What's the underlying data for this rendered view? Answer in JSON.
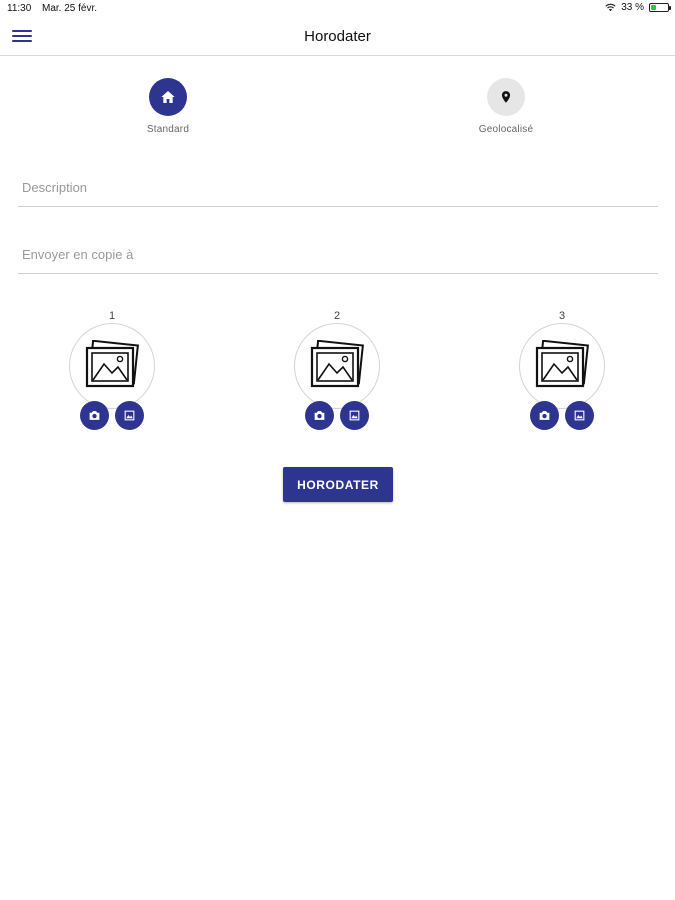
{
  "status_bar": {
    "time": "11:30",
    "date": "Mar. 25 févr.",
    "battery_text": "33 %",
    "battery_level": 0.33,
    "icons": [
      "wifi-icon",
      "battery-icon"
    ]
  },
  "header": {
    "title": "Horodater",
    "menu_icon": "hamburger-menu-icon"
  },
  "modes": [
    {
      "label": "Standard",
      "icon": "home-icon",
      "selected": true
    },
    {
      "label": "Geolocalisé",
      "icon": "location-pin-icon",
      "selected": false
    }
  ],
  "form": {
    "description_placeholder": "Description",
    "description_value": "",
    "copy_placeholder": "Envoyer en copie à",
    "copy_value": ""
  },
  "photos": [
    {
      "number": "1",
      "icon": "image-placeholder-icon",
      "actions": [
        "camera-icon",
        "gallery-icon"
      ]
    },
    {
      "number": "2",
      "icon": "image-placeholder-icon",
      "actions": [
        "camera-icon",
        "gallery-icon"
      ]
    },
    {
      "number": "3",
      "icon": "image-placeholder-icon",
      "actions": [
        "camera-icon",
        "gallery-icon"
      ]
    }
  ],
  "submit_label": "HORODATER",
  "colors": {
    "accent": "#2e3591",
    "inactive_circle": "#e6e6e6",
    "divider": "#cfcfcf",
    "placeholder_text": "#9a9a9a"
  }
}
